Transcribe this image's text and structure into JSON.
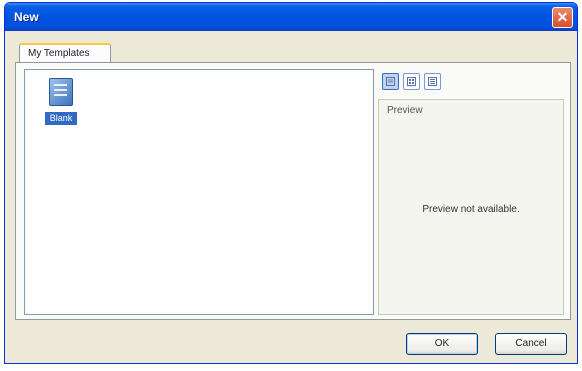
{
  "window": {
    "title": "New",
    "close_glyph": "✕",
    "close_icon": "close-icon",
    "colors": {
      "titlebar": "#0053e1",
      "face": "#ece9d8",
      "selection": "#316ac5",
      "tab_hot": "#ffc83c"
    }
  },
  "tabs": [
    {
      "label": "My Templates",
      "selected": true
    }
  ],
  "templates": [
    {
      "label": "Blank",
      "icon": "blank-document-icon",
      "selected": true
    }
  ],
  "view_buttons": [
    {
      "icon": "large-icons-view-icon",
      "active": true
    },
    {
      "icon": "small-icons-view-icon",
      "active": false
    },
    {
      "icon": "list-view-icon",
      "active": false
    }
  ],
  "preview": {
    "label": "Preview",
    "message": "Preview not available."
  },
  "buttons": {
    "ok": "OK",
    "cancel": "Cancel"
  }
}
